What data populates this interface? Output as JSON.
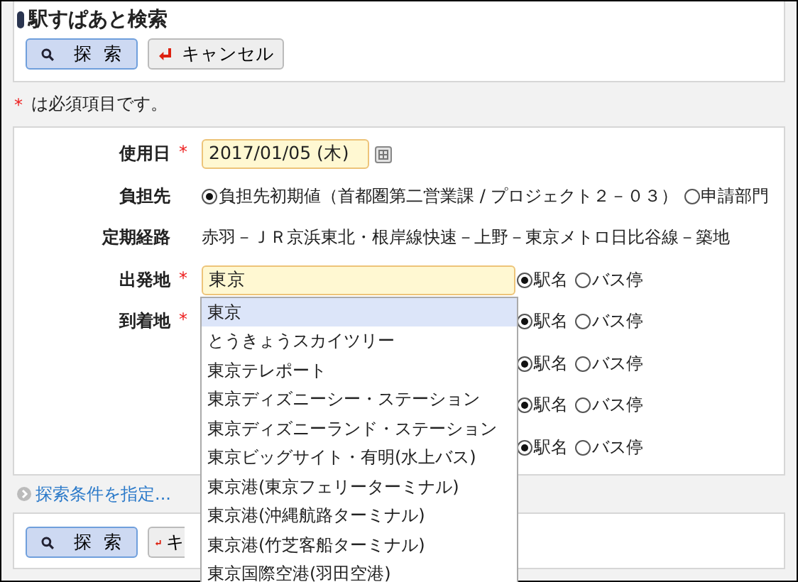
{
  "page_title": "駅すぱあと検索",
  "top_buttons": [
    {
      "kind": "search",
      "label": "探 索"
    },
    {
      "kind": "cancel",
      "label": "キャンセル"
    }
  ],
  "required_note": {
    "mark": "*",
    "text": "は必須項目です。"
  },
  "form": {
    "date": {
      "label": "使用日",
      "required_mark": "*",
      "value": "2017/01/05 (木)"
    },
    "payer": {
      "label": "負担先",
      "options": [
        {
          "label": "負担先初期値（首都圏第二営業課 / プロジェクト２－０３）",
          "selected": true
        },
        {
          "label": "申請部門",
          "selected": false
        }
      ]
    },
    "commuter_route": {
      "label": "定期経路",
      "value": "赤羽－ＪＲ京浜東北・根岸線快速－上野－東京メトロ日比谷線－築地"
    },
    "points": [
      {
        "label": "出発地",
        "required_mark": "*",
        "value": "東京",
        "options": [
          {
            "label": "駅名",
            "selected": true
          },
          {
            "label": "バス停",
            "selected": false
          }
        ]
      },
      {
        "label": "到着地",
        "required_mark": "*",
        "options": [
          {
            "label": "駅名",
            "selected": true
          },
          {
            "label": "バス停",
            "selected": false
          }
        ]
      },
      {
        "options": [
          {
            "label": "駅名",
            "selected": true
          },
          {
            "label": "バス停",
            "selected": false
          }
        ]
      },
      {
        "options": [
          {
            "label": "駅名",
            "selected": true
          },
          {
            "label": "バス停",
            "selected": false
          }
        ]
      },
      {
        "options": [
          {
            "label": "駅名",
            "selected": true
          },
          {
            "label": "バス停",
            "selected": false
          }
        ]
      }
    ]
  },
  "more_link": "探索条件を指定...",
  "bottom_buttons": [
    {
      "kind": "search",
      "label": "探 索"
    },
    {
      "kind": "cancel",
      "label": "キ"
    }
  ],
  "suggestions": [
    {
      "label": "東京",
      "selected": true
    },
    {
      "label": "とうきょうスカイツリー",
      "selected": false
    },
    {
      "label": "東京テレポート",
      "selected": false
    },
    {
      "label": "東京ディズニーシー・ステーション",
      "selected": false
    },
    {
      "label": "東京ディズニーランド・ステーション",
      "selected": false
    },
    {
      "label": "東京ビッグサイト・有明(水上バス)",
      "selected": false
    },
    {
      "label": "東京港(東京フェリーターミナル)",
      "selected": false
    },
    {
      "label": "東京港(沖縄航路ターミナル)",
      "selected": false
    },
    {
      "label": "東京港(竹芝客船ターミナル)",
      "selected": false
    },
    {
      "label": "東京国際空港(羽田空港)",
      "selected": false
    }
  ]
}
